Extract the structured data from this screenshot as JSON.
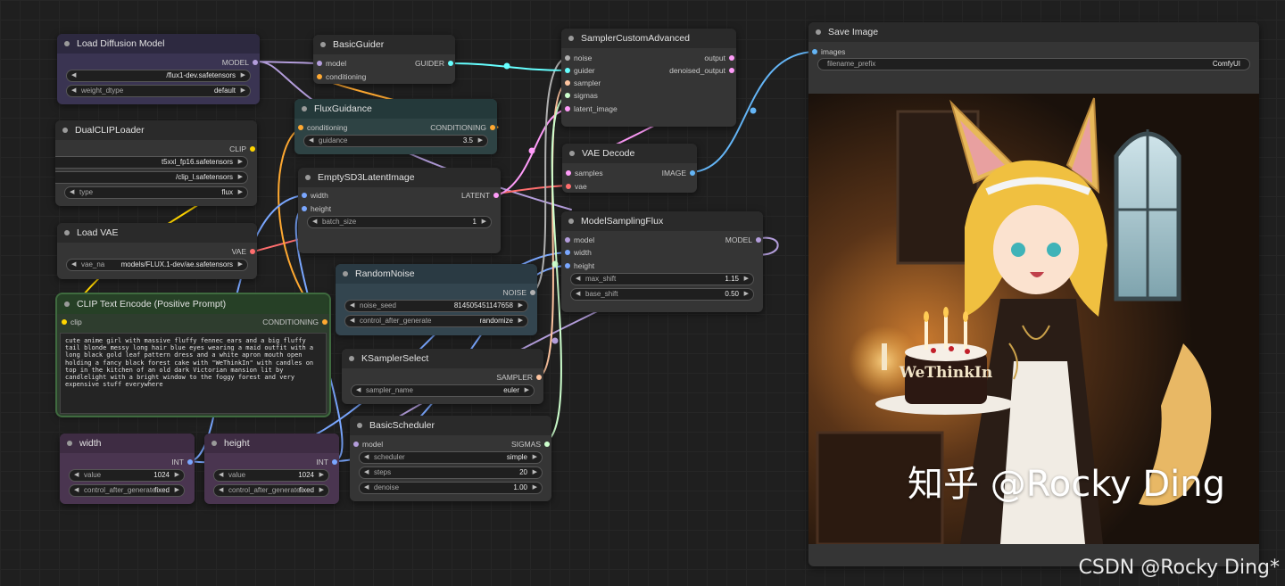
{
  "nodes": {
    "load_diffusion": {
      "title": "Load Diffusion Model",
      "output": "MODEL",
      "unet_name": "/flux1-dev.safetensors",
      "weight_dtype_label": "weight_dtype",
      "weight_dtype_value": "default"
    },
    "dual_clip": {
      "title": "DualCLIPLoader",
      "output": "CLIP",
      "clip_name1": "t5xxl_fp16.safetensors",
      "clip_name2": "/clip_l.safetensors",
      "type_label": "type",
      "type_value": "flux"
    },
    "load_vae": {
      "title": "Load VAE",
      "output": "VAE",
      "vae_name_label": "vae_na",
      "vae_name_value": "models/FLUX.1-dev/ae.safetensors"
    },
    "clip_text": {
      "title": "CLIP Text Encode (Positive Prompt)",
      "input": "clip",
      "output": "CONDITIONING",
      "prompt": "cute anime girl with massive fluffy fennec ears and a big fluffy tail blonde messy long hair blue eyes wearing a maid outfit with a long black gold leaf pattern dress and a white apron mouth open holding a fancy black forest cake with \"WeThinkIn\" with candles on top in the kitchen of an old dark Victorian mansion lit by candlelight with a bright window to the foggy forest and very expensive stuff everywhere"
    },
    "width": {
      "title": "width",
      "output": "INT",
      "value_label": "value",
      "value": "1024",
      "cag_label": "control_after_generate",
      "cag_value": "fixed"
    },
    "height": {
      "title": "height",
      "output": "INT",
      "value_label": "value",
      "value": "1024",
      "cag_label": "control_after_generate",
      "cag_value": "fixed"
    },
    "basic_guider": {
      "title": "BasicGuider",
      "inputs": [
        "model",
        "conditioning"
      ],
      "output": "GUIDER"
    },
    "flux_guidance": {
      "title": "FluxGuidance",
      "input": "conditioning",
      "output": "CONDITIONING",
      "guidance_label": "guidance",
      "guidance_value": "3.5"
    },
    "empty_latent": {
      "title": "EmptySD3LatentImage",
      "inputs": [
        "width",
        "height"
      ],
      "output": "LATENT",
      "batch_label": "batch_size",
      "batch_value": "1"
    },
    "random_noise": {
      "title": "RandomNoise",
      "output": "NOISE",
      "seed_label": "noise_seed",
      "seed_value": "814505451147658",
      "cag_label": "control_after_generate",
      "cag_value": "randomize"
    },
    "ksampler_select": {
      "title": "KSamplerSelect",
      "output": "SAMPLER",
      "sampler_label": "sampler_name",
      "sampler_value": "euler"
    },
    "basic_scheduler": {
      "title": "BasicScheduler",
      "input": "model",
      "output": "SIGMAS",
      "scheduler_label": "scheduler",
      "scheduler_value": "simple",
      "steps_label": "steps",
      "steps_value": "20",
      "denoise_label": "denoise",
      "denoise_value": "1.00"
    },
    "sampler_custom": {
      "title": "SamplerCustomAdvanced",
      "inputs": [
        "noise",
        "guider",
        "sampler",
        "sigmas",
        "latent_image"
      ],
      "outputs": [
        "output",
        "denoised_output"
      ]
    },
    "vae_decode": {
      "title": "VAE Decode",
      "inputs": [
        "samples",
        "vae"
      ],
      "output": "IMAGE"
    },
    "model_sampling": {
      "title": "ModelSamplingFlux",
      "inputs": [
        "model",
        "width",
        "height"
      ],
      "output": "MODEL",
      "max_shift_label": "max_shift",
      "max_shift_value": "1.15",
      "base_shift_label": "base_shift",
      "base_shift_value": "0.50"
    },
    "save_image": {
      "title": "Save Image",
      "input": "images",
      "prefix_label": "filename_prefix",
      "prefix_value": "ComfyUI",
      "cake_text": "WeThinkIn"
    }
  },
  "watermark": {
    "primary": "知乎 @Rocky Ding",
    "secondary": "CSDN @Rocky Ding*"
  },
  "colors": {
    "model": "#b39ddb",
    "clip": "#ffd500",
    "vae": "#ff6e6e",
    "conditioning": "#ffa931",
    "latent": "#ff9cf9",
    "int": "#7aa7ff",
    "noise": "#b0b0b0",
    "guider": "#66ffff",
    "sampler": "#ffc5a0",
    "sigmas": "#cdffcd",
    "image": "#64b5f6"
  }
}
